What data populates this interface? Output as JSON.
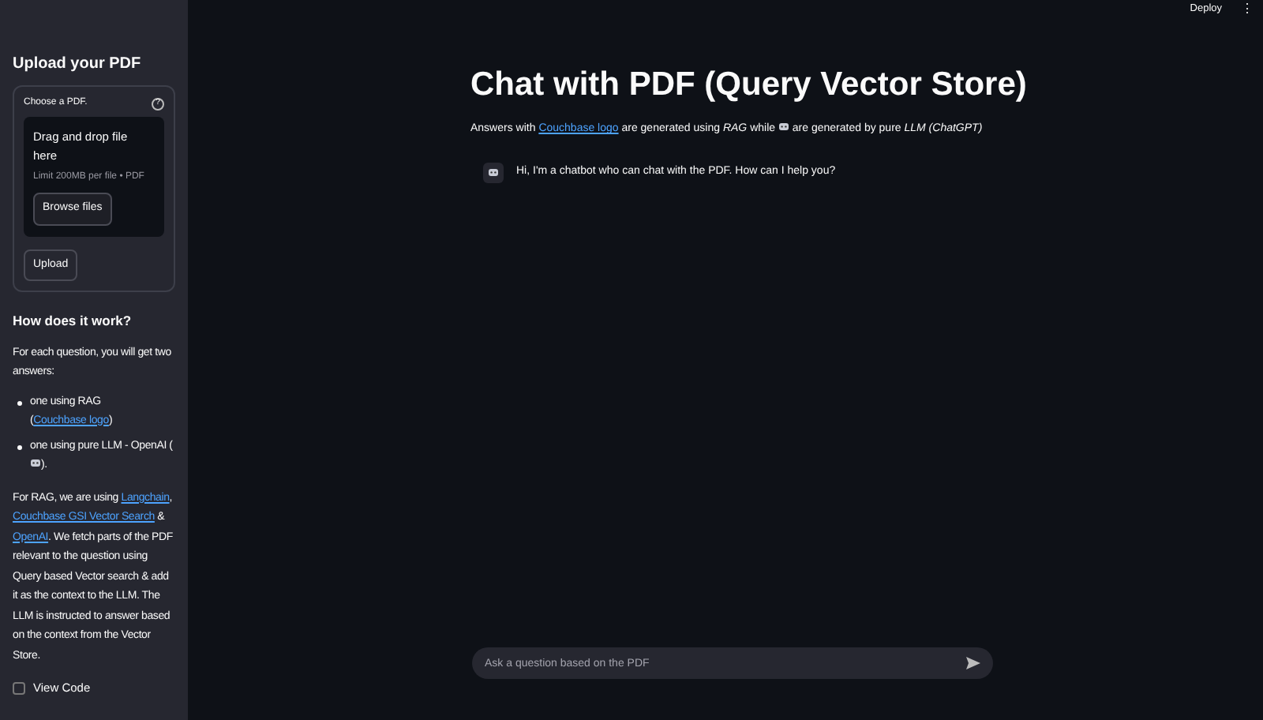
{
  "header": {
    "deploy": "Deploy",
    "menu": "⋮"
  },
  "sidebar": {
    "title": "Upload your PDF",
    "uploader": {
      "label": "Choose a PDF.",
      "help": "?",
      "drop_text": "Drag and drop file here",
      "limit": "Limit 200MB per file • PDF",
      "browse": "Browse files",
      "upload": "Upload"
    },
    "how_title": "How does it work?",
    "intro": "For each question, you will get two answers:",
    "bullets": [
      [
        {
          "kind": "text",
          "text": "one using RAG ("
        },
        {
          "kind": "link",
          "text": "Couchbase logo"
        },
        {
          "kind": "text",
          "text": ")"
        }
      ],
      [
        {
          "kind": "text",
          "text": "one using pure LLM - OpenAI ("
        },
        {
          "kind": "robot"
        },
        {
          "kind": "text",
          "text": ")."
        }
      ]
    ],
    "details": [
      {
        "kind": "text",
        "text": "For RAG, we are using "
      },
      {
        "kind": "link",
        "text": "Langchain"
      },
      {
        "kind": "text",
        "text": ", "
      },
      {
        "kind": "link",
        "text": "Couchbase GSI Vector Search"
      },
      {
        "kind": "text",
        "text": " & "
      },
      {
        "kind": "link",
        "text": "OpenAI"
      },
      {
        "kind": "text",
        "text": ". We fetch parts of the PDF relevant to the question using Query based Vector search & add it as the context to the LLM. The LLM is instructed to answer based on the context from the Vector Store."
      }
    ],
    "view_code": {
      "label": "View Code",
      "checked": false
    }
  },
  "main": {
    "title": "Chat with PDF (Query Vector Store)",
    "subtitle": [
      {
        "kind": "text",
        "text": "Answers with "
      },
      {
        "kind": "link",
        "text": "Couchbase logo"
      },
      {
        "kind": "text",
        "text": " are generated using "
      },
      {
        "kind": "italic",
        "text": "RAG"
      },
      {
        "kind": "text",
        "text": " while "
      },
      {
        "kind": "robot"
      },
      {
        "kind": "text",
        "text": " are generated by pure "
      },
      {
        "kind": "italic",
        "text": "LLM (ChatGPT)"
      }
    ],
    "messages": [
      {
        "text": "Hi, I'm a chatbot who can chat with the PDF. How can I help you?"
      }
    ],
    "chat_input": {
      "placeholder": "Ask a question based on the PDF"
    }
  }
}
